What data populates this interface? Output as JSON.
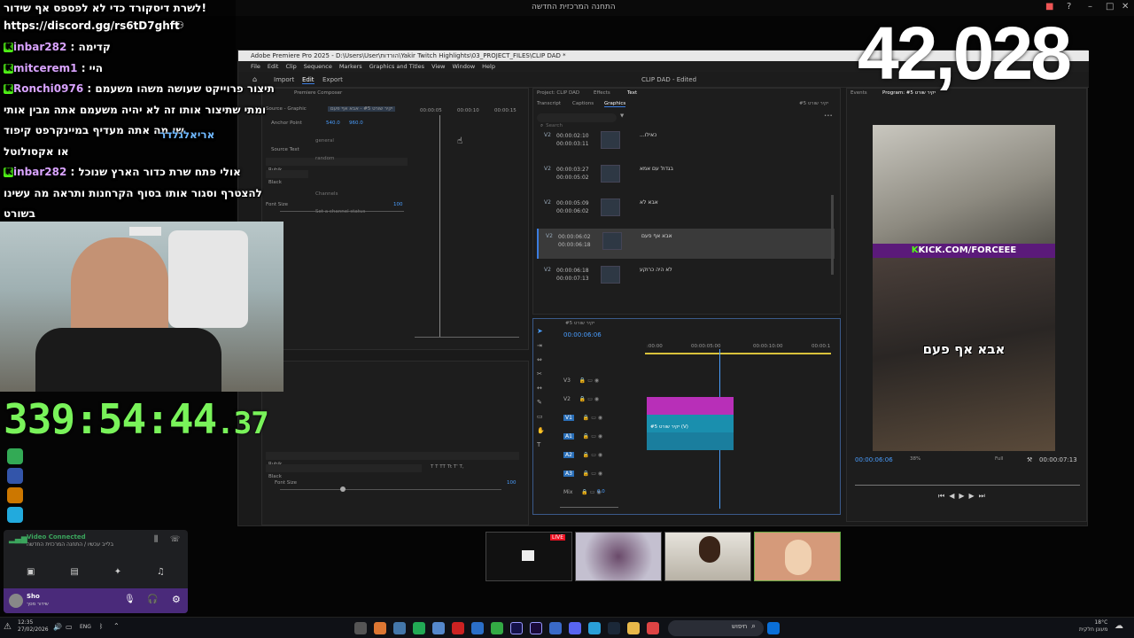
{
  "window_title": "התחנה המרכזית החדשה",
  "viewer_count": "42,028",
  "uptime": {
    "main": "339:54:44",
    "ms": ".37"
  },
  "chat": {
    "banner": "לשרת דיסקורד כדי לא לפספס אף שידור!",
    "discord_link": "https://discord.gg/rs6tD7ghft",
    "messages": [
      {
        "user": "inbar282",
        "sep": " : ",
        "text": "קדימה"
      },
      {
        "user": "mitcerem1",
        "sep": " : ",
        "text": "היי"
      },
      {
        "user": "Ronchi0976",
        "sep": " : ",
        "text": "תיצור פרוייקט שעושה משהו משעמם"
      },
      {
        "user": "",
        "sep": "",
        "text": "ומתי שתיצור אותו זה לא יהיה משעמם אתה מבין אותי"
      },
      {
        "user": "",
        "sep": "",
        "text": "שו מה אתה מעדיף במיינקרפט קיפוד"
      },
      {
        "user": "",
        "sep": "",
        "text": "או אקסולוטל"
      },
      {
        "user": "inbar282",
        "sep": " : ",
        "text": "אולי פתח שרת כדור הארץ שנוכל"
      },
      {
        "user": "",
        "sep": "",
        "text": "להצטרף וסגור אותו בסוף הקרחנות ותראה מה עשינו"
      },
      {
        "user": "",
        "sep": "",
        "text": "בשורט"
      }
    ],
    "pr_user": "אריאלגלדר"
  },
  "premiere": {
    "title": "Adobe Premiere Pro 2025 - D:\\Users\\User\\הורדות\\Yakir Twitch Highlights\\03_PROJECT_FILES\\CLIP DAD *",
    "menu": [
      "File",
      "Edit",
      "Clip",
      "Sequence",
      "Markers",
      "Graphics and Titles",
      "View",
      "Window",
      "Help"
    ],
    "workspace_tabs": [
      "Import",
      "Edit",
      "Export"
    ],
    "center_title": "CLIP DAD - Edited",
    "left_panel": {
      "tab": "Premiere Composer",
      "source": "Source - Graphic",
      "sequence": "יקיר שורט #5 - אבא אף פעם",
      "anchor_label": "Anchor Point",
      "anchor_x": "540.0",
      "anchor_y": "960.0",
      "source_text": "Source Text",
      "font": "Rubik",
      "style": "Black",
      "font_size_label": "Font Size",
      "font_size_val": "100",
      "general": "general",
      "random": "random",
      "channels": "Channels",
      "set_status": "Set a channel status",
      "time_a": "00:00:05",
      "time_b": "00:00:10",
      "time_c": "00:00:15",
      "font2": "Rubik",
      "style2": "Black",
      "font_size_label2": "Font Size",
      "font_size_val2": "100"
    },
    "project_tabs": [
      "Project: CLIP DAD",
      "Effects",
      "Text"
    ],
    "sub_tabs": [
      "Transcript",
      "Captions",
      "Graphics"
    ],
    "sequence_label": "יקיר שורט #5",
    "search_placeholder": "Search",
    "graphics": [
      {
        "track": "V2",
        "in": "00:00:02:10",
        "out": "00:00:03:11",
        "text": "כאילו..."
      },
      {
        "track": "V2",
        "in": "00:00:03:27",
        "out": "00:00:05:02",
        "text": "בגדול עם אמא"
      },
      {
        "track": "V2",
        "in": "00:00:05:09",
        "out": "00:00:06:02",
        "text": "אבא לא"
      },
      {
        "track": "V2",
        "in": "00:00:06:02",
        "out": "00:00:06:18",
        "text": "אבא אף פעם"
      },
      {
        "track": "V2",
        "in": "00:00:06:18",
        "out": "00:00:07:13",
        "text": "לא היה כרוקע"
      }
    ],
    "timeline": {
      "name": "יקיר שורט #5",
      "timecode": "00:00:06:06",
      "ruler": [
        ":00:00",
        "00:00:05:00",
        "00:00:10:00",
        "00:00:1"
      ],
      "tracks": [
        "V3",
        "V2",
        "V1",
        "A1",
        "A2",
        "A3",
        "Mix"
      ],
      "clip_label": "יקיר שורט #5 (V)",
      "mix_val": "0.0"
    },
    "program": {
      "tab_effects": "Events",
      "tab_program": "Program: #5 יקיר שורט",
      "timecode_left": "00:00:06:06",
      "zoom": "38%",
      "quality": "Full",
      "timecode_right": "00:00:07:13",
      "kick_url": "KICK.COM/FORCEEE",
      "caption": "אבא אף פעם"
    }
  },
  "discord": {
    "status": "Video Connected",
    "channel": "בלייב עכשיו / התחנה המרכזית החדשה",
    "user": "Sho",
    "user_sub": "שידור מסך"
  },
  "taskbar": {
    "time": "12:35",
    "date": "27/02/2026",
    "lang": "ENG",
    "search": "חיפוש",
    "weather_temp": "18°C",
    "weather_text": "מעונן חלקית"
  },
  "stream_row": {
    "live_badge": "LIVE"
  },
  "colors": {
    "kick_green": "#53fc18",
    "timer_green": "#79f35a",
    "accent_blue": "#3b7de0",
    "clip_magenta": "#b82fb8",
    "clip_teal": "#1a8fae"
  }
}
